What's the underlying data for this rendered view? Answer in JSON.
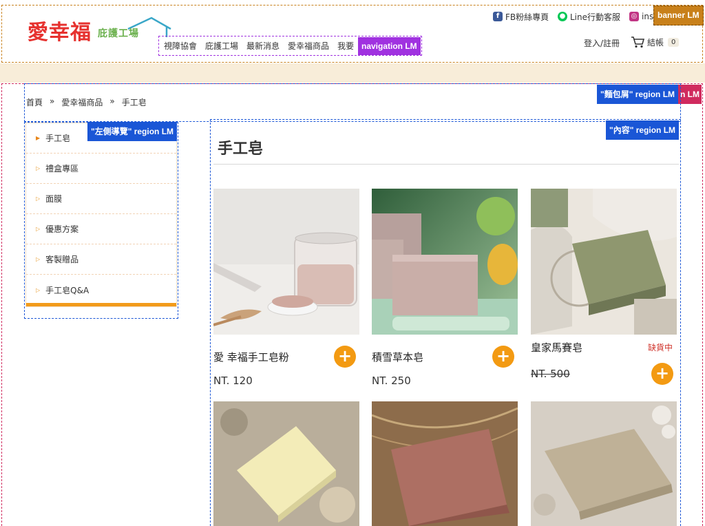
{
  "header": {
    "logo_main": "愛幸福",
    "logo_sub": "庇護工場",
    "social": [
      {
        "icon": "facebook-icon",
        "label": "FB粉絲專頁",
        "color": "#3b5998"
      },
      {
        "icon": "line-icon",
        "label": "Line行動客服",
        "color": "#06c755"
      },
      {
        "icon": "instagram-icon",
        "label": "ins",
        "color": "#c13584"
      }
    ],
    "nav": [
      "視障協會",
      "庇護工場",
      "最新消息",
      "愛幸福商品",
      "我要"
    ],
    "login": "登入/註冊",
    "checkout": "結帳",
    "cart_count": "0"
  },
  "labels": {
    "banner": "banner LM",
    "navigation": "navigation LM",
    "breadcrumb_region": "\"麵包屑\" region LM",
    "region_edge": "n LM",
    "sidebar_region": "\"左側導覽\" region LM",
    "content_region": "\"內容\" region LM"
  },
  "breadcrumb": [
    "首頁",
    "愛幸福商品",
    "手工皂"
  ],
  "breadcrumb_sep": "»",
  "sidebar": {
    "items": [
      "手工皂",
      "禮盒專區",
      "面膜",
      "優惠方案",
      "客製贈品",
      "手工皂Q&A"
    ]
  },
  "content": {
    "title": "手工皂",
    "products": [
      {
        "name": "愛 幸福手工皂粉",
        "price": "NT. 120",
        "sold_out": ""
      },
      {
        "name": "積雪草本皂",
        "price": "NT. 250",
        "sold_out": ""
      },
      {
        "name": "皇家馬賽皂",
        "price": "NT. 500",
        "sold_out": "缺貨中"
      }
    ]
  },
  "colors": {
    "accent_orange": "#f39a12",
    "brand_red": "#e6312e",
    "brand_green": "#6ab04c",
    "beige_band": "#f8edd9",
    "lm_blue": "#1a56d6",
    "lm_purple": "#a032e0",
    "lm_brown": "#c8801a",
    "lm_pink": "#d02a5e"
  }
}
